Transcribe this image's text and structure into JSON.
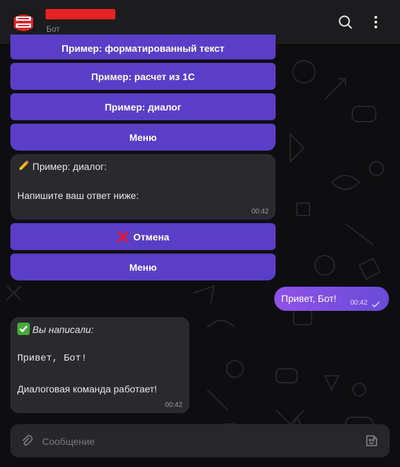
{
  "header": {
    "title": "",
    "subtitle": "Бот",
    "avatar_text": "ЧАТ ЧАТ",
    "search_icon": "search-icon",
    "menu_icon": "more-vertical-icon"
  },
  "keyboard_top": {
    "buttons": [
      {
        "label": "Пример: форматированный текст"
      },
      {
        "label": "Пример: расчет из 1С"
      },
      {
        "label": "Пример: диалог"
      },
      {
        "label": "Меню"
      }
    ]
  },
  "message_dialog": {
    "emoji": "pencil-emoji",
    "title": "Пример: диалог:",
    "body": "Напишите ваш ответ ниже:",
    "time": "00:42"
  },
  "keyboard_dialog": {
    "buttons": [
      {
        "label": "Отмена",
        "icon": "cross-mark-icon"
      },
      {
        "label": "Меню"
      }
    ]
  },
  "message_user": {
    "text": "Привет, Бот!",
    "time": "00:42",
    "status_icon": "check-icon"
  },
  "message_reply": {
    "emoji": "check-mark-button-emoji",
    "heading": "Вы написали:",
    "code": "Привет, Бот!",
    "body": "Диалоговая команда работает!",
    "time": "00:42"
  },
  "composer": {
    "placeholder": "Сообщение",
    "attach_icon": "paperclip-icon",
    "sticker_icon": "sticker-icon"
  },
  "colors": {
    "accent": "#5a3ec8",
    "bubble_in": "#2a2a2e",
    "header": "#1c1c1e",
    "background": "#0e0e10",
    "redacted": "#e52222"
  }
}
